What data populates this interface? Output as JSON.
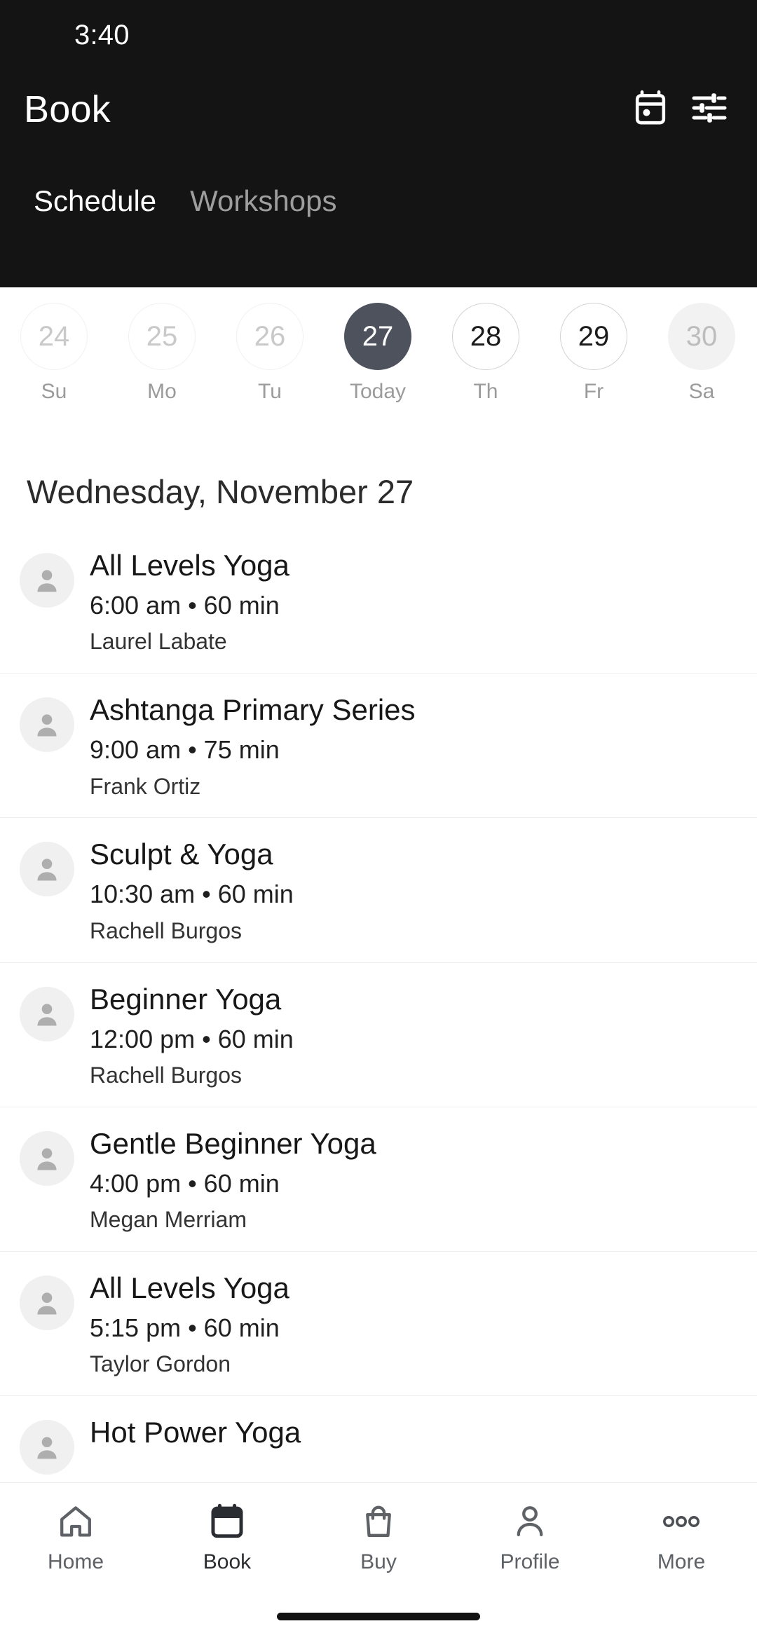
{
  "status_bar": {
    "time": "3:40"
  },
  "header": {
    "title": "Book",
    "actions": [
      {
        "name": "calendar-icon",
        "label": "Calendar"
      },
      {
        "name": "filter-icon",
        "label": "Filters"
      }
    ]
  },
  "tabs": [
    {
      "label": "Schedule",
      "active": true
    },
    {
      "label": "Workshops",
      "active": false
    }
  ],
  "date_strip": {
    "days": [
      {
        "date": "24",
        "weekday": "Su",
        "state": "past"
      },
      {
        "date": "25",
        "weekday": "Mo",
        "state": "past"
      },
      {
        "date": "26",
        "weekday": "Tu",
        "state": "past"
      },
      {
        "date": "27",
        "weekday": "Today",
        "state": "selected"
      },
      {
        "date": "28",
        "weekday": "Th",
        "state": "avail"
      },
      {
        "date": "29",
        "weekday": "Fr",
        "state": "avail"
      },
      {
        "date": "30",
        "weekday": "Sa",
        "state": "muted"
      }
    ]
  },
  "schedule": {
    "date_heading": "Wednesday, November 27",
    "classes": [
      {
        "title": "All Levels Yoga",
        "meta": "6:00 am • 60 min",
        "teacher": "Laurel Labate"
      },
      {
        "title": "Ashtanga Primary Series",
        "meta": "9:00 am • 75 min",
        "teacher": "Frank Ortiz"
      },
      {
        "title": "Sculpt & Yoga",
        "meta": "10:30 am • 60 min",
        "teacher": "Rachell Burgos"
      },
      {
        "title": "Beginner Yoga",
        "meta": "12:00 pm • 60 min",
        "teacher": "Rachell Burgos"
      },
      {
        "title": "Gentle Beginner Yoga",
        "meta": "4:00 pm • 60 min",
        "teacher": "Megan Merriam"
      },
      {
        "title": "All Levels Yoga",
        "meta": "5:15 pm • 60 min",
        "teacher": "Taylor Gordon"
      },
      {
        "title": "Hot Power Yoga",
        "meta": "",
        "teacher": ""
      }
    ]
  },
  "bottom_nav": {
    "items": [
      {
        "label": "Home",
        "icon": "home-icon",
        "active": false
      },
      {
        "label": "Book",
        "icon": "calendar-icon",
        "active": true
      },
      {
        "label": "Buy",
        "icon": "bag-icon",
        "active": false
      },
      {
        "label": "Profile",
        "icon": "person-icon",
        "active": false
      },
      {
        "label": "More",
        "icon": "ellipsis-icon",
        "active": false
      }
    ]
  },
  "colors": {
    "header_bg": "#141414",
    "selected_day": "#4d525c",
    "muted_day": "#f2f2f2",
    "accent_text": "#171717"
  }
}
